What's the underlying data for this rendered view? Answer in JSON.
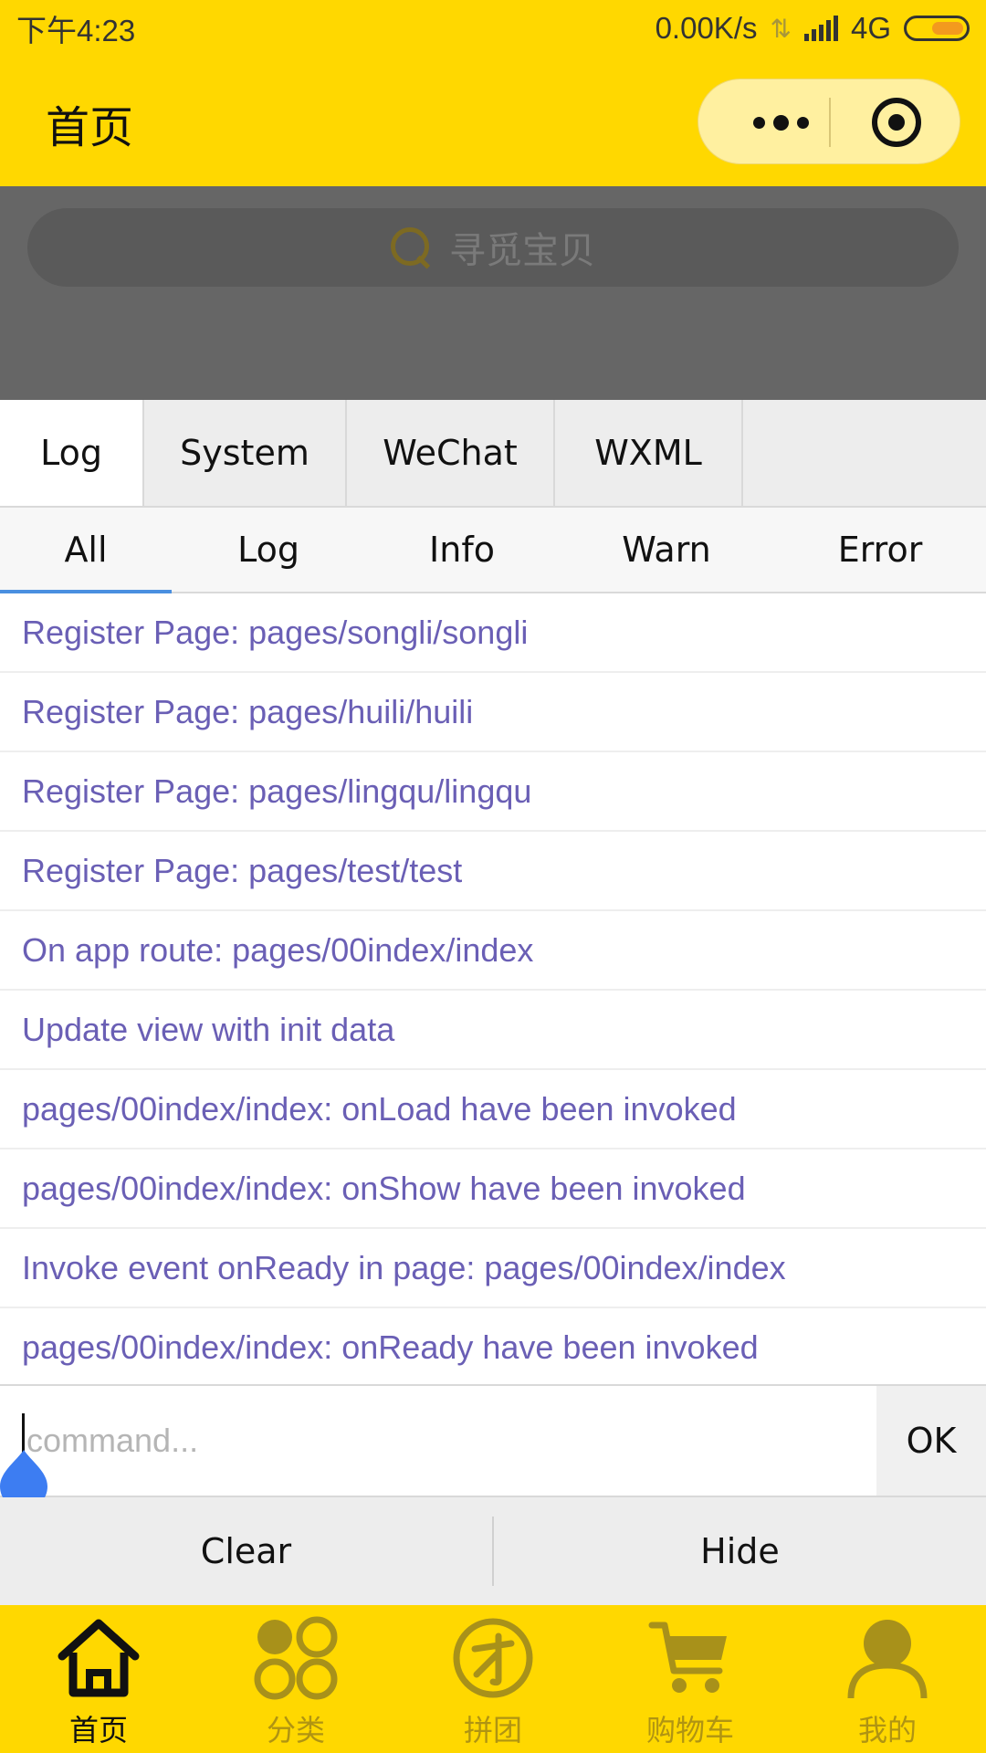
{
  "status_bar": {
    "time": "下午4:23",
    "speed": "0.00K/s",
    "network": "4G"
  },
  "nav": {
    "title": "首页"
  },
  "search": {
    "placeholder": "寻觅宝贝"
  },
  "console": {
    "tabs": [
      "Log",
      "System",
      "WeChat",
      "WXML"
    ],
    "active_tab": "Log",
    "filters": [
      "All",
      "Log",
      "Info",
      "Warn",
      "Error"
    ],
    "active_filter": "All",
    "logs": [
      "Register Page: pages/songli/songli",
      "Register Page: pages/huili/huili",
      "Register Page: pages/lingqu/lingqu",
      "Register Page: pages/test/test",
      "On app route: pages/00index/index",
      "Update view with init data",
      "pages/00index/index: onLoad have been invoked",
      "pages/00index/index: onShow have been invoked",
      "Invoke event onReady in page: pages/00index/index",
      "pages/00index/index: onReady have been invoked"
    ],
    "command": {
      "value": "",
      "placeholder": "command...",
      "ok_label": "OK"
    },
    "footer": {
      "clear_label": "Clear",
      "hide_label": "Hide"
    }
  },
  "tab_bar": {
    "items": [
      {
        "label": "首页",
        "icon": "home-icon"
      },
      {
        "label": "分类",
        "icon": "category-icon"
      },
      {
        "label": "拼团",
        "icon": "group-buy-icon"
      },
      {
        "label": "购物车",
        "icon": "cart-icon"
      },
      {
        "label": "我的",
        "icon": "profile-icon"
      }
    ],
    "active_index": 0
  },
  "colors": {
    "brand_yellow": "#FFD800",
    "log_text": "#6a5fb5",
    "active_underline": "#4a8fe0",
    "tab_inactive": "#b09412"
  }
}
